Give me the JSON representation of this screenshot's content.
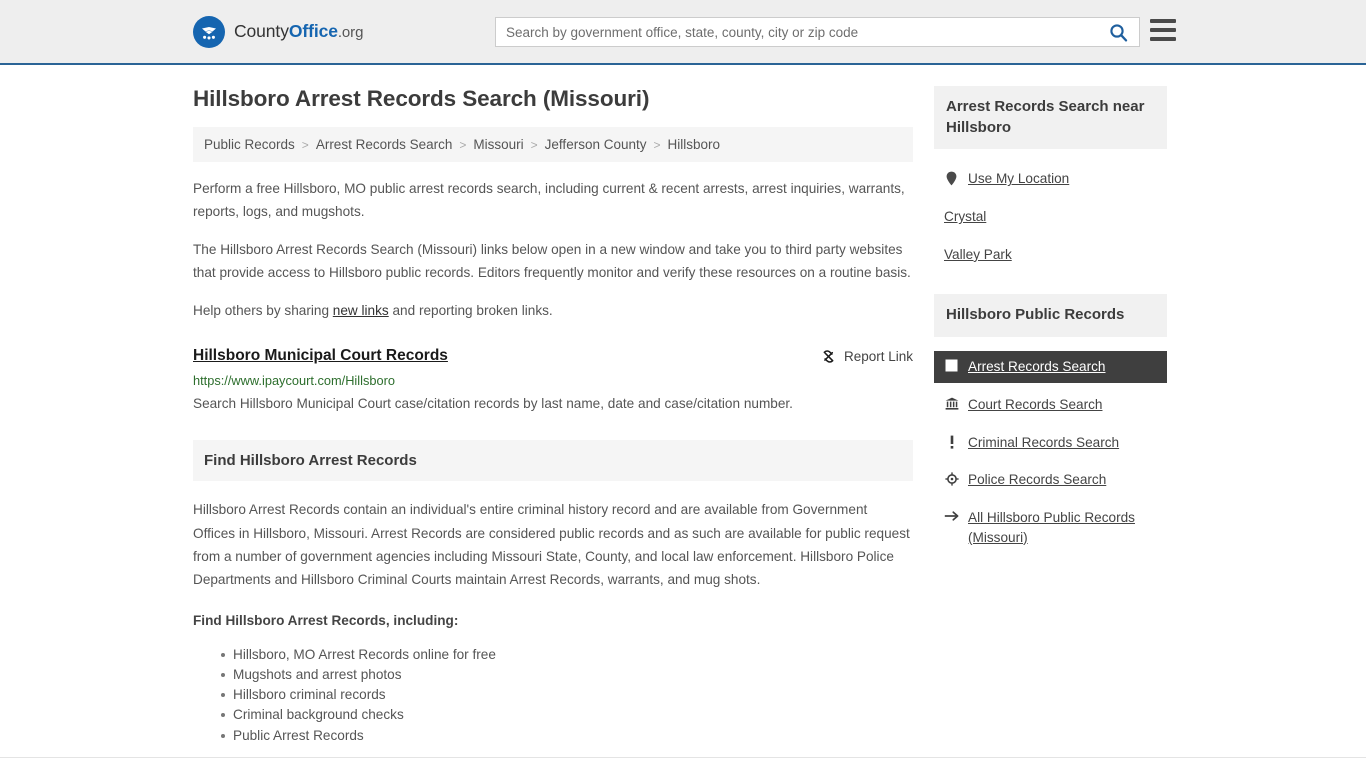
{
  "header": {
    "brand": {
      "part1": "County",
      "part2": "Office",
      "part3": ".org",
      "logo_icon": "eagle-stars-logo"
    },
    "search": {
      "placeholder": "Search by government office, state, county, city or zip code",
      "value": "",
      "icon": "search-icon"
    },
    "menu_icon": "hamburger-menu-icon"
  },
  "page": {
    "title": "Hillsboro Arrest Records Search (Missouri)",
    "breadcrumb": [
      "Public Records",
      "Arrest Records Search",
      "Missouri",
      "Jefferson County",
      "Hillsboro"
    ],
    "breadcrumb_separator": ">",
    "intro_1": "Perform a free Hillsboro, MO public arrest records search, including current & recent arrests, arrest inquiries, warrants, reports, logs, and mugshots.",
    "intro_2": "The Hillsboro Arrest Records Search (Missouri) links below open in a new window and take you to third party websites that provide access to Hillsboro public records. Editors frequently monitor and verify these resources on a routine basis.",
    "help_prefix": "Help others by sharing ",
    "help_link": "new links",
    "help_suffix": " and reporting broken links."
  },
  "result": {
    "title": "Hillsboro Municipal Court Records",
    "report_label": "Report Link",
    "report_icon": "broken-link-icon",
    "url": "https://www.ipaycourt.com/Hillsboro",
    "description": "Search Hillsboro Municipal Court case/citation records by last name, date and case/citation number."
  },
  "find_section": {
    "heading": "Find Hillsboro Arrest Records",
    "body": "Hillsboro Arrest Records contain an individual's entire criminal history record and are available from Government Offices in Hillsboro, Missouri. Arrest Records are considered public records and as such are available for public request from a number of government agencies including Missouri State, County, and local law enforcement. Hillsboro Police Departments and Hillsboro Criminal Courts maintain Arrest Records, warrants, and mug shots.",
    "list_heading": "Find Hillsboro Arrest Records, including:",
    "bullets": [
      "Hillsboro, MO Arrest Records online for free",
      "Mugshots and arrest photos",
      "Hillsboro criminal records",
      "Criminal background checks",
      "Public Arrest Records"
    ]
  },
  "sidebar": {
    "nearby": {
      "heading": "Arrest Records Search near Hillsboro",
      "items": [
        {
          "label": "Use My Location",
          "icon": "map-pin-icon"
        },
        {
          "label": "Crystal",
          "icon": "none"
        },
        {
          "label": "Valley Park",
          "icon": "none"
        }
      ]
    },
    "public_records": {
      "heading": "Hillsboro Public Records",
      "items": [
        {
          "label": "Arrest Records Search",
          "icon": "square-icon",
          "active": true
        },
        {
          "label": "Court Records Search",
          "icon": "courthouse-icon",
          "active": false
        },
        {
          "label": "Criminal Records Search",
          "icon": "exclamation-icon",
          "active": false
        },
        {
          "label": "Police Records Search",
          "icon": "police-badge-icon",
          "active": false
        },
        {
          "label": "All Hillsboro Public Records (Missouri)",
          "icon": "arrow-right-icon",
          "active": false
        }
      ]
    }
  },
  "colors": {
    "brand_blue": "#1565b0",
    "header_border": "#2a6496",
    "url_green": "#2d6e2d",
    "active_bg": "#3f3f3f",
    "panel_gray": "#f1f1f1"
  }
}
